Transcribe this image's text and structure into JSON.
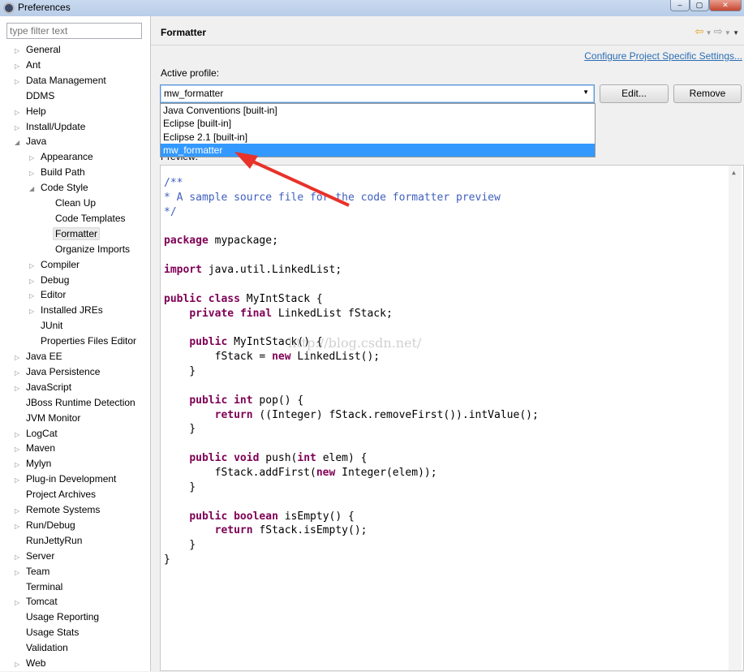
{
  "window": {
    "title": "Preferences"
  },
  "filter": {
    "placeholder": "type filter text"
  },
  "tree": [
    {
      "label": "General",
      "level": 0,
      "arrow": "collapsed"
    },
    {
      "label": "Ant",
      "level": 0,
      "arrow": "collapsed"
    },
    {
      "label": "Data Management",
      "level": 0,
      "arrow": "collapsed"
    },
    {
      "label": "DDMS",
      "level": 0,
      "arrow": "none"
    },
    {
      "label": "Help",
      "level": 0,
      "arrow": "collapsed"
    },
    {
      "label": "Install/Update",
      "level": 0,
      "arrow": "collapsed"
    },
    {
      "label": "Java",
      "level": 0,
      "arrow": "expanded"
    },
    {
      "label": "Appearance",
      "level": 1,
      "arrow": "collapsed"
    },
    {
      "label": "Build Path",
      "level": 1,
      "arrow": "collapsed"
    },
    {
      "label": "Code Style",
      "level": 1,
      "arrow": "expanded"
    },
    {
      "label": "Clean Up",
      "level": 2,
      "arrow": "none"
    },
    {
      "label": "Code Templates",
      "level": 2,
      "arrow": "none"
    },
    {
      "label": "Formatter",
      "level": 2,
      "arrow": "none",
      "selected": true
    },
    {
      "label": "Organize Imports",
      "level": 2,
      "arrow": "none"
    },
    {
      "label": "Compiler",
      "level": 1,
      "arrow": "collapsed"
    },
    {
      "label": "Debug",
      "level": 1,
      "arrow": "collapsed"
    },
    {
      "label": "Editor",
      "level": 1,
      "arrow": "collapsed"
    },
    {
      "label": "Installed JREs",
      "level": 1,
      "arrow": "collapsed"
    },
    {
      "label": "JUnit",
      "level": 1,
      "arrow": "none"
    },
    {
      "label": "Properties Files Editor",
      "level": 1,
      "arrow": "none"
    },
    {
      "label": "Java EE",
      "level": 0,
      "arrow": "collapsed"
    },
    {
      "label": "Java Persistence",
      "level": 0,
      "arrow": "collapsed"
    },
    {
      "label": "JavaScript",
      "level": 0,
      "arrow": "collapsed"
    },
    {
      "label": "JBoss Runtime Detection",
      "level": 0,
      "arrow": "none"
    },
    {
      "label": "JVM Monitor",
      "level": 0,
      "arrow": "none"
    },
    {
      "label": "LogCat",
      "level": 0,
      "arrow": "collapsed"
    },
    {
      "label": "Maven",
      "level": 0,
      "arrow": "collapsed"
    },
    {
      "label": "Mylyn",
      "level": 0,
      "arrow": "collapsed"
    },
    {
      "label": "Plug-in Development",
      "level": 0,
      "arrow": "collapsed"
    },
    {
      "label": "Project Archives",
      "level": 0,
      "arrow": "none"
    },
    {
      "label": "Remote Systems",
      "level": 0,
      "arrow": "collapsed"
    },
    {
      "label": "Run/Debug",
      "level": 0,
      "arrow": "collapsed"
    },
    {
      "label": "RunJettyRun",
      "level": 0,
      "arrow": "none"
    },
    {
      "label": "Server",
      "level": 0,
      "arrow": "collapsed"
    },
    {
      "label": "Team",
      "level": 0,
      "arrow": "collapsed"
    },
    {
      "label": "Terminal",
      "level": 0,
      "arrow": "none"
    },
    {
      "label": "Tomcat",
      "level": 0,
      "arrow": "collapsed"
    },
    {
      "label": "Usage Reporting",
      "level": 0,
      "arrow": "none"
    },
    {
      "label": "Usage Stats",
      "level": 0,
      "arrow": "none"
    },
    {
      "label": "Validation",
      "level": 0,
      "arrow": "none"
    },
    {
      "label": "Web",
      "level": 0,
      "arrow": "collapsed"
    }
  ],
  "page": {
    "title": "Formatter",
    "configure_link": "Configure Project Specific Settings...",
    "active_profile_label": "Active profile:",
    "profile_value": "mw_formatter",
    "edit_label": "Edit...",
    "remove_label": "Remove",
    "preview_label": "Preview:"
  },
  "profile_options": [
    {
      "label": "Java Conventions [built-in]"
    },
    {
      "label": "Eclipse [built-in]"
    },
    {
      "label": "Eclipse 2.1 [built-in]"
    },
    {
      "label": "mw_formatter",
      "highlighted": true
    }
  ],
  "watermark": "http://blog.csdn.net/",
  "colors": {
    "keyword": "#7f0055",
    "comment": "#3f5fbf",
    "selection": "#3399ff",
    "link": "#2a6db4",
    "annotation_arrow": "#e8322a"
  },
  "code": [
    [
      [
        "c",
        "/**"
      ]
    ],
    [
      [
        "c",
        "* A sample source file for the code formatter preview"
      ]
    ],
    [
      [
        "c",
        "*/"
      ]
    ],
    [],
    [
      [
        "k",
        "package"
      ],
      [
        "t",
        " mypackage;"
      ]
    ],
    [],
    [
      [
        "k",
        "import"
      ],
      [
        "t",
        " java.util.LinkedList;"
      ]
    ],
    [],
    [
      [
        "k",
        "public"
      ],
      [
        "t",
        " "
      ],
      [
        "k",
        "class"
      ],
      [
        "t",
        " MyIntStack {"
      ]
    ],
    [
      [
        "t",
        "    "
      ],
      [
        "k",
        "private"
      ],
      [
        "t",
        " "
      ],
      [
        "k",
        "final"
      ],
      [
        "t",
        " LinkedList fStack;"
      ]
    ],
    [],
    [
      [
        "t",
        "    "
      ],
      [
        "k",
        "public"
      ],
      [
        "t",
        " MyIntStack() {"
      ]
    ],
    [
      [
        "t",
        "        fStack = "
      ],
      [
        "k",
        "new"
      ],
      [
        "t",
        " LinkedList();"
      ]
    ],
    [
      [
        "t",
        "    }"
      ]
    ],
    [],
    [
      [
        "t",
        "    "
      ],
      [
        "k",
        "public"
      ],
      [
        "t",
        " "
      ],
      [
        "k",
        "int"
      ],
      [
        "t",
        " pop() {"
      ]
    ],
    [
      [
        "t",
        "        "
      ],
      [
        "k",
        "return"
      ],
      [
        "t",
        " ((Integer) fStack.removeFirst()).intValue();"
      ]
    ],
    [
      [
        "t",
        "    }"
      ]
    ],
    [],
    [
      [
        "t",
        "    "
      ],
      [
        "k",
        "public"
      ],
      [
        "t",
        " "
      ],
      [
        "k",
        "void"
      ],
      [
        "t",
        " push("
      ],
      [
        "k",
        "int"
      ],
      [
        "t",
        " elem) {"
      ]
    ],
    [
      [
        "t",
        "        fStack.addFirst("
      ],
      [
        "k",
        "new"
      ],
      [
        "t",
        " Integer(elem));"
      ]
    ],
    [
      [
        "t",
        "    }"
      ]
    ],
    [],
    [
      [
        "t",
        "    "
      ],
      [
        "k",
        "public"
      ],
      [
        "t",
        " "
      ],
      [
        "k",
        "boolean"
      ],
      [
        "t",
        " isEmpty() {"
      ]
    ],
    [
      [
        "t",
        "        "
      ],
      [
        "k",
        "return"
      ],
      [
        "t",
        " fStack.isEmpty();"
      ]
    ],
    [
      [
        "t",
        "    }"
      ]
    ],
    [
      [
        "t",
        "}"
      ]
    ]
  ]
}
